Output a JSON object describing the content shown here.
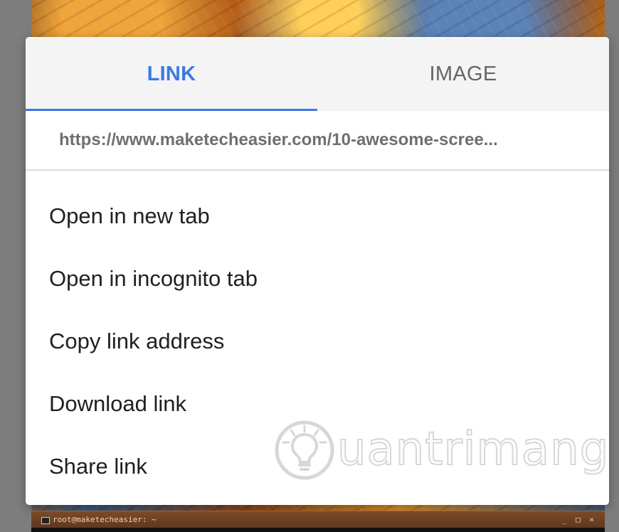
{
  "dialog": {
    "tabs": [
      {
        "label": "LINK",
        "active": true
      },
      {
        "label": "IMAGE",
        "active": false
      }
    ],
    "url": "https://www.maketecheasier.com/10-awesome-scree...",
    "menu_items": [
      {
        "label": "Open in new tab"
      },
      {
        "label": "Open in incognito tab"
      },
      {
        "label": "Copy link address"
      },
      {
        "label": "Download link"
      },
      {
        "label": "Share link"
      }
    ]
  },
  "background": {
    "terminal_title": "root@maketecheasier: ~",
    "terminal_controls": "_ □ ×"
  },
  "watermark": {
    "text": "uantrimang",
    "icon": "lightbulb-icon"
  },
  "colors": {
    "accent": "#3b78e7",
    "tab_background": "#f4f4f4",
    "text_primary": "#202020",
    "text_secondary": "#656565",
    "divider": "#dcdcdc"
  }
}
